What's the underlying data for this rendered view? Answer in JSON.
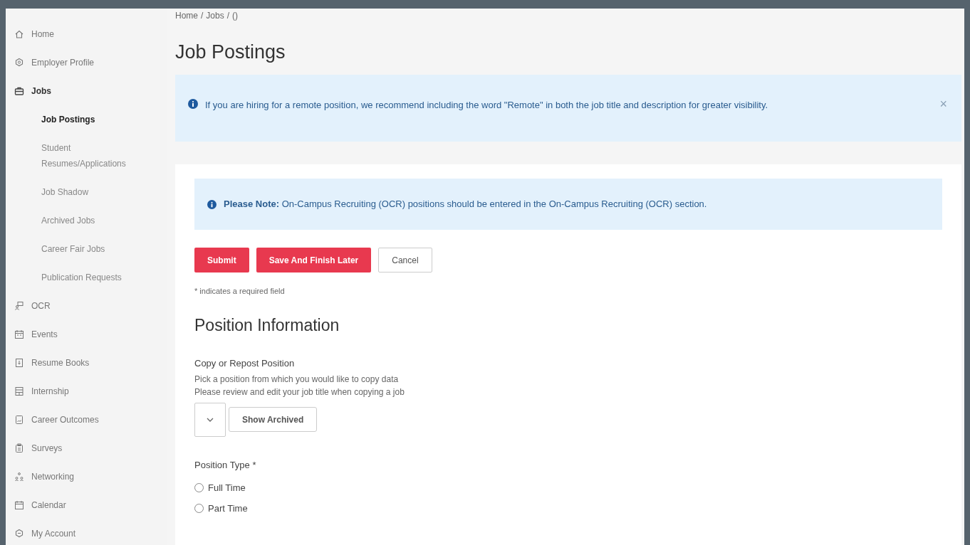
{
  "sidebar": {
    "items": [
      {
        "label": "Home",
        "selected": false
      },
      {
        "label": "Employer Profile",
        "selected": false
      },
      {
        "label": "Jobs",
        "selected": false,
        "expanded": true,
        "children": [
          {
            "label": "Job Postings",
            "selected": true
          },
          {
            "label": "Student Resumes/Applications",
            "selected": false
          },
          {
            "label": "Job Shadow",
            "selected": false
          },
          {
            "label": "Archived Jobs",
            "selected": false
          },
          {
            "label": "Career Fair Jobs",
            "selected": false
          },
          {
            "label": "Publication Requests",
            "selected": false
          }
        ]
      },
      {
        "label": "OCR",
        "selected": false
      },
      {
        "label": "Events",
        "selected": false
      },
      {
        "label": "Resume Books",
        "selected": false
      },
      {
        "label": "Internship",
        "selected": false
      },
      {
        "label": "Career Outcomes",
        "selected": false
      },
      {
        "label": "Surveys",
        "selected": false
      },
      {
        "label": "Networking",
        "selected": false
      },
      {
        "label": "Calendar",
        "selected": false
      },
      {
        "label": "My Account",
        "selected": false
      }
    ]
  },
  "breadcrumb": [
    "Home",
    "Jobs",
    "()"
  ],
  "breadcrumb_separator": "/",
  "page_title": "Job Postings",
  "remote_alert": {
    "text": "If you are hiring for a remote position, we recommend including the word \"Remote\" in both the job title and description for greater visibility.",
    "close": "×"
  },
  "note_alert": {
    "text": "**Please Note:** On-Campus Recruiting (OCR) positions should be entered in the On-Campus Recruiting (OCR) section."
  },
  "buttons": [
    {
      "label": "Submit",
      "kind": "primary"
    },
    {
      "label": "Save And Finish Later",
      "kind": "primary"
    },
    {
      "label": "Cancel",
      "kind": "secondary"
    }
  ],
  "required_note": "* indicates a required field",
  "section_title": "Position Information",
  "copy_position": {
    "label": "Copy or Repost Position",
    "help": [
      "Pick a position from which you would like to copy data",
      "Please review and edit your job title when copying a job"
    ],
    "button": "Show Archived"
  },
  "position_type": {
    "label": "Position Type *",
    "options": [
      {
        "label": "Full Time",
        "selected": false
      },
      {
        "label": "Part Time",
        "selected": false
      }
    ]
  }
}
